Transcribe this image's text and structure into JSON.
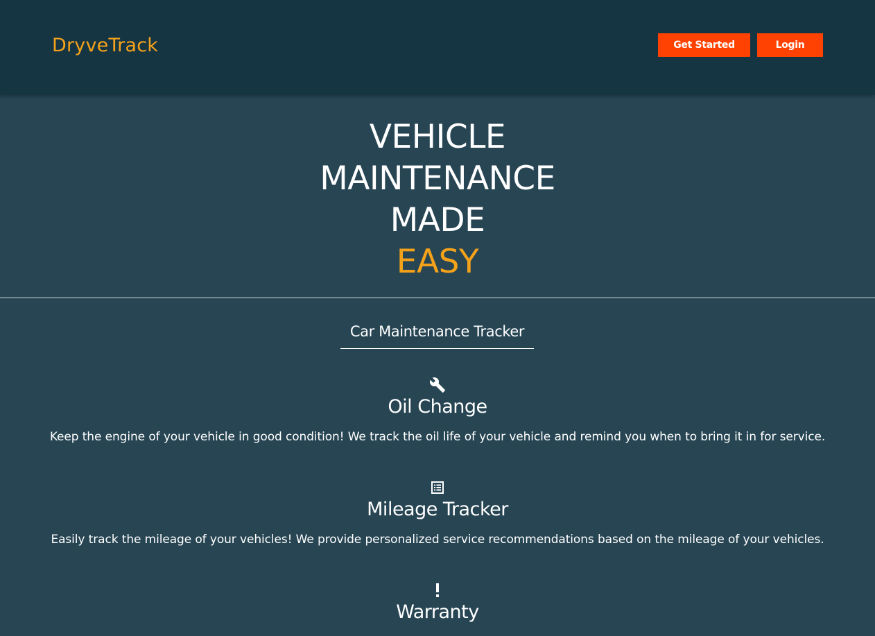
{
  "header": {
    "brand": "DryveTrack",
    "get_started_label": "Get Started",
    "login_label": "Login"
  },
  "hero": {
    "lines": [
      "VEHICLE",
      "MAINTENANCE",
      "MADE"
    ],
    "accent": "EASY"
  },
  "section": {
    "title": "Car Maintenance Tracker"
  },
  "features": [
    {
      "icon": "wrench-icon",
      "title": "Oil Change",
      "description": "Keep the engine of your vehicle in good condition! We track the oil life of your vehicle and remind you when to bring it in for service."
    },
    {
      "icon": "list-icon",
      "title": "Mileage Tracker",
      "description": "Easily track the mileage of your vehicles! We provide personalized service recommendations based on the mileage of your vehicles."
    },
    {
      "icon": "exclamation-icon",
      "title": "Warranty",
      "description": ""
    }
  ],
  "colors": {
    "background": "#274553",
    "header_background": "#163543",
    "accent": "#f5a21b",
    "button": "#ff4201"
  }
}
